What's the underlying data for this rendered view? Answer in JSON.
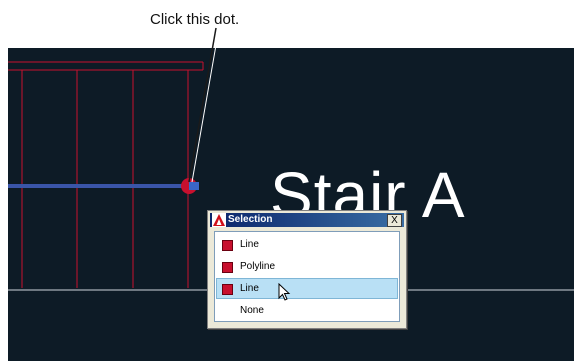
{
  "callout": {
    "text": "Click this dot."
  },
  "drawing": {
    "label": "Stair A"
  },
  "selection_dialog": {
    "title": "Selection",
    "close_label": "X",
    "items": [
      {
        "label": "Line",
        "has_swatch": true
      },
      {
        "label": "Polyline",
        "has_swatch": true
      },
      {
        "label": "Line",
        "has_swatch": true,
        "hovered": true
      },
      {
        "label": "None",
        "has_swatch": false
      }
    ]
  },
  "colors": {
    "canvas_bg": "#0d1b26",
    "stair_lines": "#c8102e",
    "selected_line": "#3a55a8",
    "grip_dot": "#c8102e",
    "hover_row": "#b9e0f5"
  }
}
